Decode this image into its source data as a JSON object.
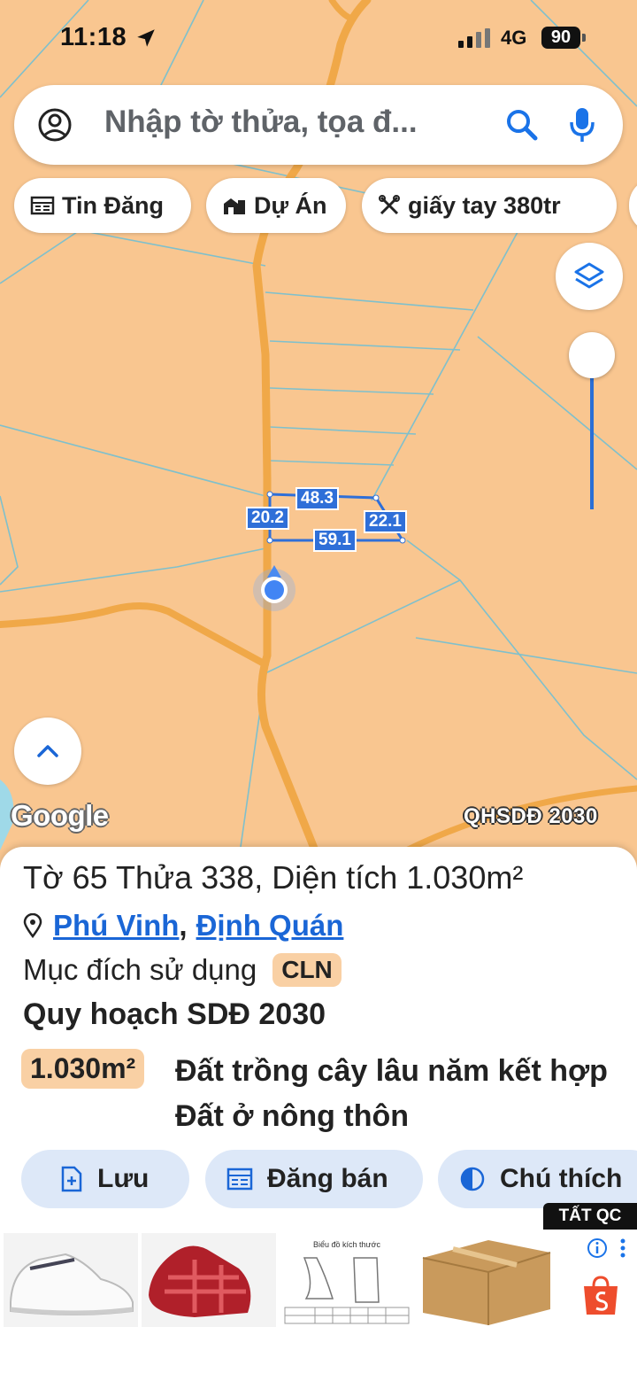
{
  "status_bar": {
    "time": "11:18",
    "network": "4G",
    "battery": "90"
  },
  "search": {
    "placeholder": "Nhập tờ thửa, tọa đ..."
  },
  "chips": [
    {
      "label": "Tin Đăng",
      "icon": "news-icon"
    },
    {
      "label": "Dự Án",
      "icon": "building-icon"
    },
    {
      "label": "giấy tay 380tr",
      "icon": "tools-icon"
    }
  ],
  "map": {
    "parcel_dimensions": {
      "top": "48.3",
      "left": "20.2",
      "right": "22.1",
      "bottom": "59.1"
    },
    "attribution": "Google",
    "overlay_label": "QHSDĐ 2030"
  },
  "parcel": {
    "title": "Tờ 65 Thửa 338, Diện tích 1.030m²",
    "commune": "Phú Vinh",
    "district": "Định Quán",
    "separator": ",",
    "purpose_label": "Mục đích sử dụng",
    "purpose_code": "CLN",
    "planning_title": "Quy hoạch SDĐ 2030",
    "planning_area": "1.030m²",
    "planning_desc": "Đất trồng cây lâu năm kết hợp Đất ở nông thôn"
  },
  "actions": {
    "save": "Lưu",
    "post_sale": "Đăng bán",
    "legend": "Chú thích"
  },
  "ad": {
    "close_label": "TẤT QC",
    "size_chart_title": "Biểu đồ kích thước"
  },
  "colors": {
    "map_land": "#f9c690",
    "road": "#f3a94e",
    "accent": "#1a66d6",
    "badge": "#f9d0a4",
    "action_bg": "#dde8f8"
  }
}
